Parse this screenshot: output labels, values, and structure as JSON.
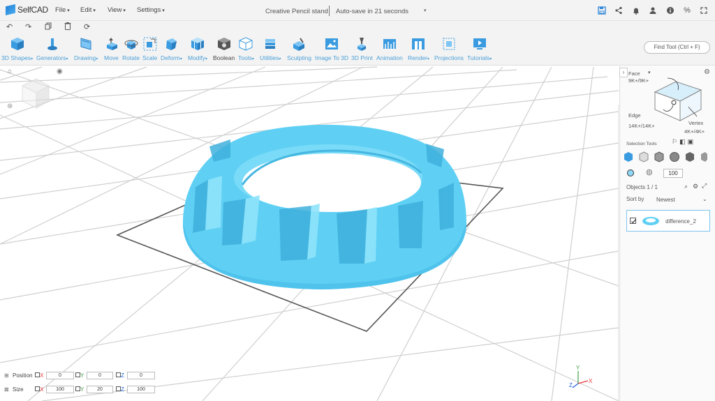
{
  "app": {
    "name": "SelfCAD"
  },
  "menus": [
    "File",
    "Edit",
    "View",
    "Settings"
  ],
  "document": {
    "title": "Creative Pencil stand",
    "autosave": "Auto-save in 21 seconds"
  },
  "topright_icons": [
    "save-icon",
    "share-icon",
    "bell-icon",
    "user-icon",
    "info-icon",
    "percent-icon",
    "fullscreen-icon"
  ],
  "quickbar_icons": [
    "undo-icon",
    "redo-icon",
    "copy-icon",
    "delete-icon",
    "refresh-icon"
  ],
  "toolbar": {
    "items": [
      {
        "label": "3D Shapes",
        "dropdown": true
      },
      {
        "label": "Generators",
        "dropdown": true
      },
      {
        "label": "Drawing",
        "dropdown": true
      },
      {
        "label": "Move",
        "dropdown": false
      },
      {
        "label": "Rotate",
        "dropdown": false
      },
      {
        "label": "Scale",
        "dropdown": false
      },
      {
        "label": "Deform",
        "dropdown": true
      },
      {
        "label": "Modify",
        "dropdown": true
      },
      {
        "label": "Boolean",
        "dropdown": false
      },
      {
        "label": "Tools",
        "dropdown": true
      },
      {
        "label": "Utilities",
        "dropdown": true
      },
      {
        "label": "Sculpting",
        "dropdown": false
      },
      {
        "label": "Image To 3D",
        "dropdown": false
      },
      {
        "label": "3D Print",
        "dropdown": false
      },
      {
        "label": "Animation",
        "dropdown": false
      },
      {
        "label": "Render",
        "dropdown": true
      },
      {
        "label": "Projections",
        "dropdown": false
      },
      {
        "label": "Tutorials",
        "dropdown": true
      }
    ],
    "find_tool": "Find Tool (Ctrl + F)"
  },
  "right_panel": {
    "face_label": "Face",
    "face_count": "9K+/9K+",
    "edge_label": "Edge",
    "edge_count": "14K+/14K+",
    "vertex_label": "Vertex",
    "vertex_count": "4K+/4K+",
    "selection_tools": "Selection Tools",
    "opacity": "100",
    "objects": "Objects 1 / 1",
    "sort_by": "Sort by",
    "sort_value": "Newest",
    "object_name": "difference_2"
  },
  "transform": {
    "position_label": "Position",
    "size_label": "Size",
    "position": {
      "x": "0",
      "y": "0",
      "z": "0"
    },
    "size": {
      "x": "100",
      "y": "20",
      "z": "100"
    },
    "axis_x": "X",
    "axis_y": "Y",
    "axis_z": "Z"
  },
  "colors": {
    "accent": "#4a9fd8",
    "model": "#62d0f5",
    "axis_x": "#e53935",
    "axis_y": "#43a047",
    "axis_z": "#1e5fd6"
  }
}
